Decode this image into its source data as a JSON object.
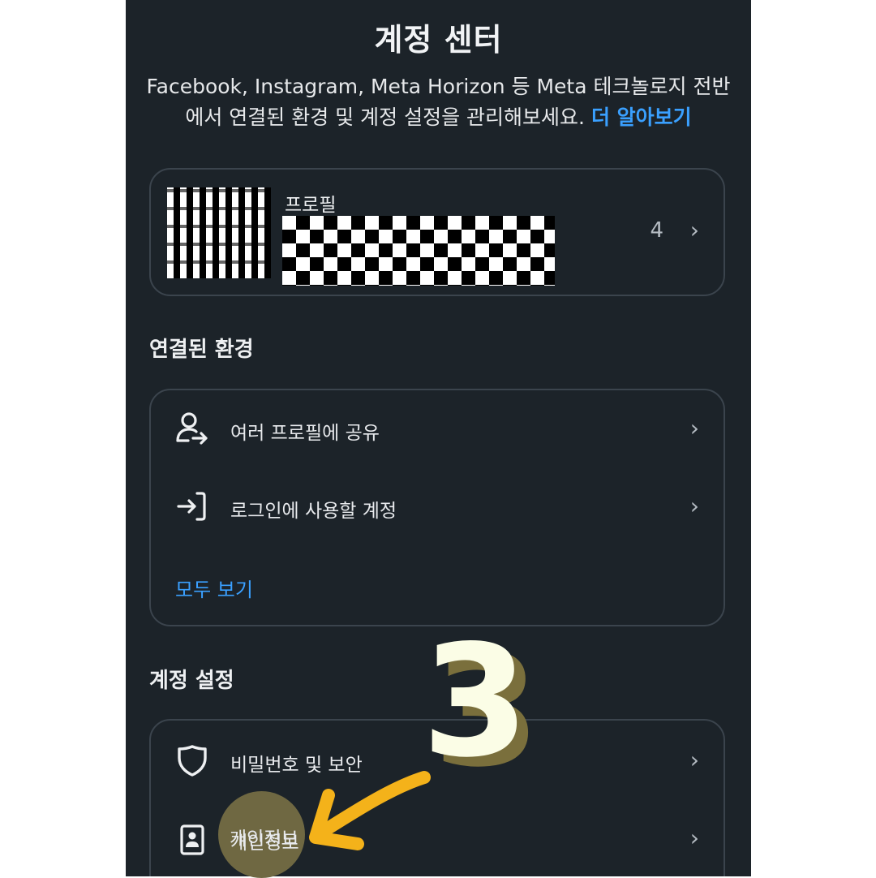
{
  "header": {
    "title": "계정 센터",
    "description": "Facebook, Instagram, Meta Horizon 등 Meta 테크놀로지 전반에서 연결된 환경 및 계정 설정을 관리해보세요.",
    "learn_more": "더 알아보기"
  },
  "profile_card": {
    "label": "프로필",
    "count": "4",
    "chevron": "›"
  },
  "connected": {
    "title": "연결된 환경",
    "items": [
      {
        "label": "여러 프로필에 공유",
        "icon": "person-share-icon",
        "chevron": "›"
      },
      {
        "label": "로그인에 사용할 계정",
        "icon": "login-arrow-icon",
        "chevron": "›"
      }
    ],
    "see_all": "모두 보기"
  },
  "settings": {
    "title": "계정 설정",
    "items": [
      {
        "label": "비밀번호 및 보안",
        "icon": "shield-icon",
        "chevron": "›"
      },
      {
        "label": "개인정보",
        "icon": "id-card-icon",
        "chevron": "›"
      }
    ]
  },
  "annotation": {
    "step_number": "3",
    "arrow_color": "#f4b21a",
    "highlight_color": "#6f6842"
  },
  "colors": {
    "background": "#1c2329",
    "link": "#3aa0ff",
    "card_border": "#3b444d"
  }
}
